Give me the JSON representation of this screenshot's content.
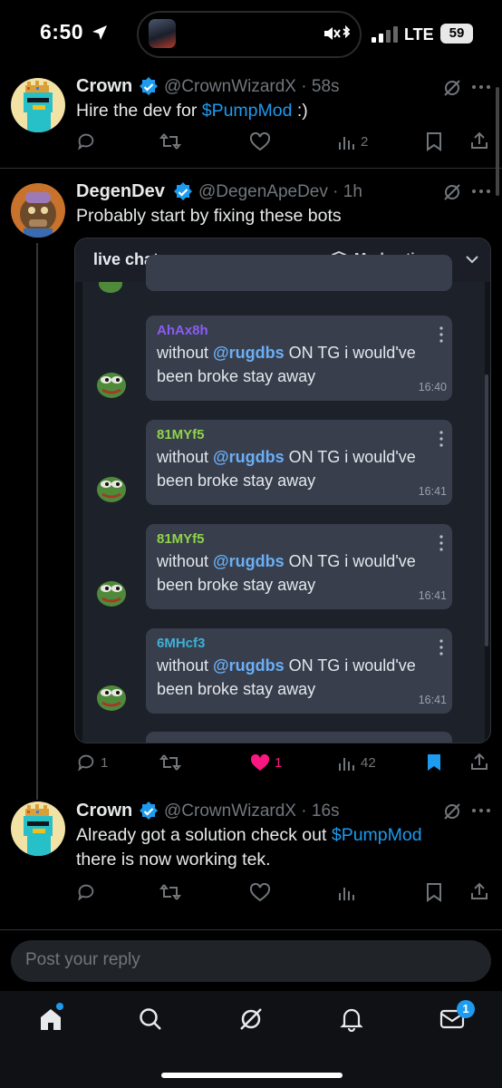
{
  "status_bar": {
    "time": "6:50",
    "network": "LTE",
    "battery": "59"
  },
  "tweets": [
    {
      "name": "Crown",
      "handle": "@CrownWizardX",
      "age": "58s",
      "text_prefix": "Hire the dev for ",
      "cashtag": "$PumpMod",
      "text_suffix": " :)",
      "views": "2"
    },
    {
      "name": "DegenDev",
      "handle": "@DegenApeDev",
      "age": "1h",
      "text": "Probably start by fixing these bots",
      "replies": "1",
      "likes": "1",
      "views": "42"
    },
    {
      "name": "Crown",
      "handle": "@CrownWizardX",
      "age": "16s",
      "text_line1_prefix": "Already got a solution check out ",
      "cashtag": "$PumpMod",
      "text_line2": "there is now working tek."
    }
  ],
  "live_chat": {
    "title": "live chat",
    "moderation_label": "Moderation",
    "messages": [
      {
        "user": "AhAx8h",
        "user_color": "#8a5cf5",
        "mention": "@rugdbs",
        "pre": "without ",
        "post": " ON TG i would've",
        "line2": "been broke stay away",
        "time": "16:40"
      },
      {
        "user": "81MYf5",
        "user_color": "#8fd44a",
        "mention": "@rugdbs",
        "pre": "without ",
        "post": " ON TG i would've",
        "line2": "been broke stay away",
        "time": "16:41"
      },
      {
        "user": "81MYf5",
        "user_color": "#8fd44a",
        "mention": "@rugdbs",
        "pre": "without ",
        "post": " ON TG i would've",
        "line2": "been broke stay away",
        "time": "16:41"
      },
      {
        "user": "6MHcf3",
        "user_color": "#3fb0d8",
        "mention": "@rugdbs",
        "pre": "without ",
        "post": " ON TG i would've",
        "line2": "been broke stay away",
        "time": "16:41"
      }
    ]
  },
  "reply_box": {
    "placeholder": "Post your reply"
  },
  "tab_bar": {
    "messages_badge": "1"
  },
  "colors": {
    "accent": "#1d9bf0",
    "like": "#f91880",
    "background": "#000000"
  }
}
